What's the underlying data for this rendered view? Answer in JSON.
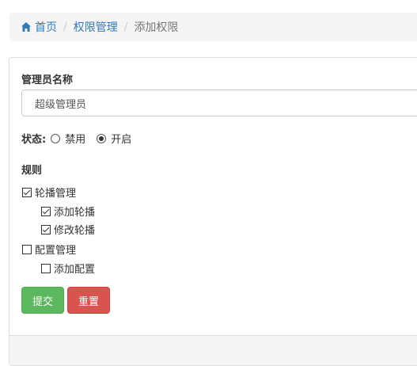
{
  "breadcrumb": {
    "home": "首页",
    "section": "权限管理",
    "current": "添加权限",
    "separator": "/"
  },
  "form": {
    "name_label": "管理员名称",
    "name_value": "超级管理员",
    "status_label": "状态:",
    "status_options": [
      "禁用",
      "开启"
    ],
    "status_selected": "开启",
    "rules_label": "规则",
    "rules": [
      {
        "label": "轮播管理",
        "checked": true,
        "children": [
          {
            "label": "添加轮播",
            "checked": true
          },
          {
            "label": "修改轮播",
            "checked": true
          }
        ]
      },
      {
        "label": "配置管理",
        "checked": false,
        "children": [
          {
            "label": "添加配置",
            "checked": false
          }
        ]
      }
    ],
    "submit_label": "提交",
    "reset_label": "重置"
  },
  "colors": {
    "link": "#337ab7",
    "submit": "#5cb85c",
    "reset": "#d9534f"
  }
}
